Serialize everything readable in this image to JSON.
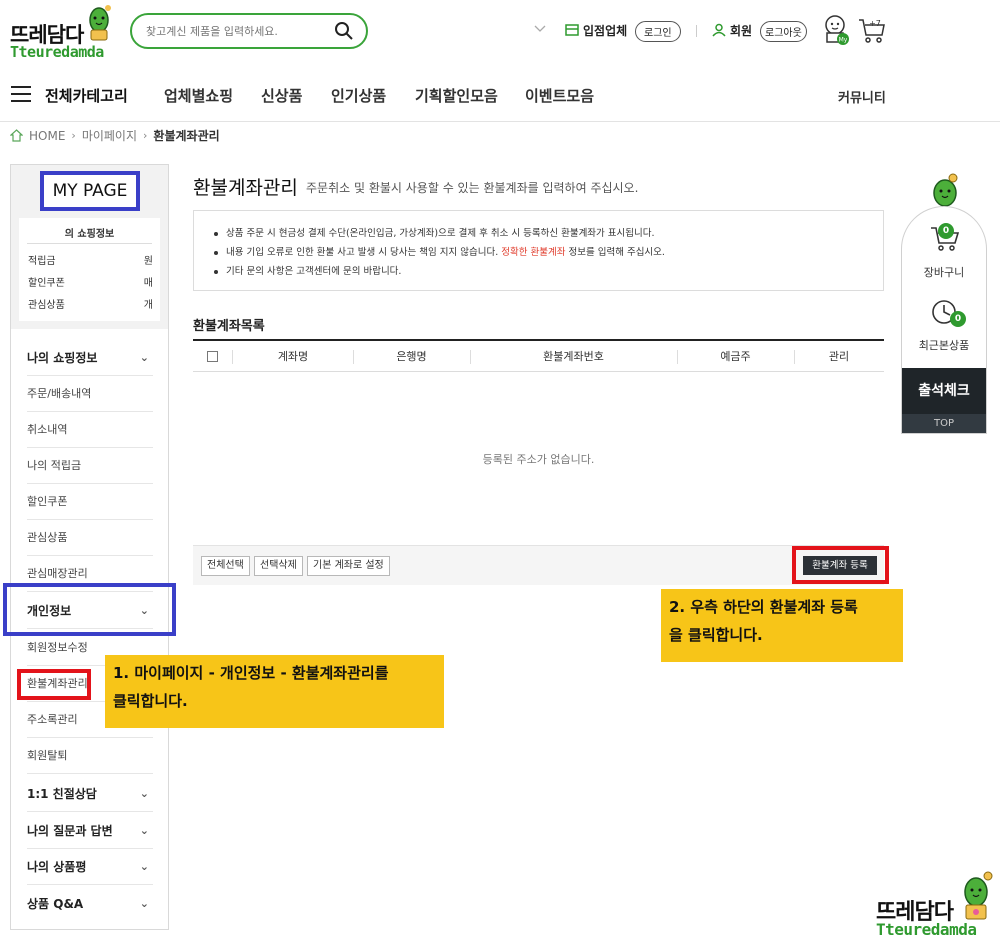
{
  "brand": {
    "name_kr": "뜨레담다",
    "name_en": "Tteuredamda"
  },
  "search": {
    "placeholder": "찾고계신 제품을 입력하세요."
  },
  "header": {
    "vendor_label": "입점업체",
    "login_label": "로그인",
    "member_label": "회원",
    "logout_label": "로그아웃",
    "my_badge": "My",
    "cart_badge": "+7"
  },
  "nav": {
    "all_categories": "전체카테고리",
    "items": [
      "업체별쇼핑",
      "신상품",
      "인기상품",
      "기획할인모음",
      "이벤트모음"
    ],
    "community": "커뮤니티"
  },
  "breadcrumb": {
    "home": "HOME",
    "level1": "마이페이지",
    "current": "환불계좌관리"
  },
  "sidebar": {
    "title": "MY PAGE",
    "shop_info_title": "의 쇼핑정보",
    "shop_rows": [
      {
        "label": "적립금",
        "value": "원"
      },
      {
        "label": "할인쿠폰",
        "value": "매"
      },
      {
        "label": "관심상품",
        "value": "개"
      }
    ],
    "menu": [
      {
        "label": "나의 쇼핑정보",
        "bold": true,
        "chevron": "⌄"
      },
      {
        "label": "주문/배송내역"
      },
      {
        "label": "취소내역"
      },
      {
        "label": "나의 적립금"
      },
      {
        "label": "할인쿠폰"
      },
      {
        "label": "관심상품"
      },
      {
        "label": "관심매장관리"
      },
      {
        "label": "개인정보",
        "bold": true,
        "chevron": "⌄"
      },
      {
        "label": "회원정보수정"
      },
      {
        "label": "환불계좌관리"
      },
      {
        "label": "주소록관리"
      },
      {
        "label": "회원탈퇴"
      },
      {
        "label": "1:1 친절상담",
        "bold": true,
        "chevron": "⌄"
      },
      {
        "label": "나의 질문과 답변",
        "bold": true,
        "chevron": "⌄"
      },
      {
        "label": "나의 상품평",
        "bold": true,
        "chevron": "⌄"
      },
      {
        "label": "상품 Q&A",
        "bold": true,
        "chevron": "⌄"
      }
    ]
  },
  "main": {
    "title": "환불계좌관리",
    "subtitle": "주문취소 및 환불시 사용할 수 있는 환불계좌를 입력하여 주십시오.",
    "notices": {
      "n1": "상품 주문 시 현금성 결제 수단(온라인입금, 가상계좌)으로 결제 후 취소 시 등록하신 환불계좌가 표시됩니다.",
      "n2_pre": "내용 기입 오류로 인한 환불 사고 발생 시 당사는 책임 지지 않습니다. ",
      "n2_red": "정확한 환불계좌",
      "n2_post": " 정보를 입력해 주십시오.",
      "n3": "기타 문의 사항은 고객센터에 문의 바랍니다."
    },
    "list_title": "환불계좌목록",
    "columns": [
      "계좌명",
      "은행명",
      "환불계좌번호",
      "예금주",
      "관리"
    ],
    "empty_message": "등록된 주소가 없습니다.",
    "buttons": {
      "select_all": "전체선택",
      "delete_selected": "선택삭제",
      "set_default": "기본 계좌로 설정",
      "register": "환불계좌 등록"
    }
  },
  "callouts": {
    "step1_line1": "1. 마이페이지 - 개인정보 - 환불계좌관리를",
    "step1_line2": "클릭합니다.",
    "step2_line1": "2. 우측 하단의 환불계좌 등록",
    "step2_line2": "을 클릭합니다."
  },
  "right_panel": {
    "cart_count": "0",
    "cart_label": "장바구니",
    "recent_count": "0",
    "recent_label": "최근본상품",
    "attendance": "출석체크",
    "top": "TOP"
  },
  "colors": {
    "brand_green": "#2f9a2f",
    "highlight_blue": "#3a3fc8",
    "highlight_red": "#e3131a",
    "callout_yellow": "#f7c518"
  }
}
